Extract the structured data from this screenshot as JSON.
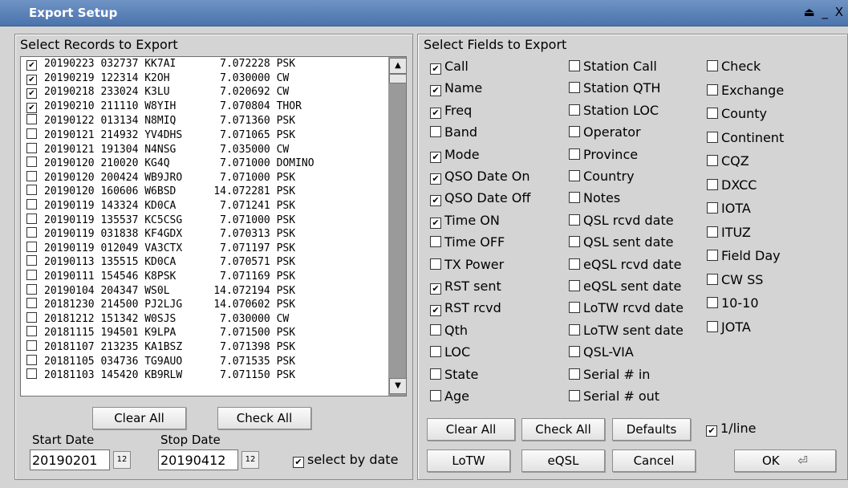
{
  "window": {
    "title": "Export Setup",
    "controls": "⏏ _ X"
  },
  "left": {
    "title": "Select Records to Export",
    "records": [
      {
        "checked": true,
        "text": "20190223 032737 KK7AI       7.072228 PSK"
      },
      {
        "checked": true,
        "text": "20190219 122314 K2OH        7.030000 CW"
      },
      {
        "checked": true,
        "text": "20190218 233024 K3LU        7.020692 CW"
      },
      {
        "checked": true,
        "text": "20190210 211110 W8YIH       7.070804 THOR"
      },
      {
        "checked": false,
        "text": "20190122 013134 N8MIQ       7.071360 PSK"
      },
      {
        "checked": false,
        "text": "20190121 214932 YV4DHS      7.071065 PSK"
      },
      {
        "checked": false,
        "text": "20190121 191304 N4NSG       7.035000 CW"
      },
      {
        "checked": false,
        "text": "20190120 210020 KG4Q        7.071000 DOMINO"
      },
      {
        "checked": false,
        "text": "20190120 200424 WB9JRO      7.071000 PSK"
      },
      {
        "checked": false,
        "text": "20190120 160606 W6BSD      14.072281 PSK"
      },
      {
        "checked": false,
        "text": "20190119 143324 KD0CA       7.071241 PSK"
      },
      {
        "checked": false,
        "text": "20190119 135537 KC5CSG      7.071000 PSK"
      },
      {
        "checked": false,
        "text": "20190119 031838 KF4GDX      7.070313 PSK"
      },
      {
        "checked": false,
        "text": "20190119 012049 VA3CTX      7.071197 PSK"
      },
      {
        "checked": false,
        "text": "20190113 135515 KD0CA       7.070571 PSK"
      },
      {
        "checked": false,
        "text": "20190111 154546 K8PSK       7.071169 PSK"
      },
      {
        "checked": false,
        "text": "20190104 204347 WS0L       14.072194 PSK"
      },
      {
        "checked": false,
        "text": "20181230 214500 PJ2LJG     14.070602 PSK"
      },
      {
        "checked": false,
        "text": "20181212 151342 W0SJS       7.030000 CW"
      },
      {
        "checked": false,
        "text": "20181115 194501 K9LPA       7.071500 PSK"
      },
      {
        "checked": false,
        "text": "20181107 213235 KA1BSZ      7.071398 PSK"
      },
      {
        "checked": false,
        "text": "20181105 034736 TG9AUO      7.071535 PSK"
      },
      {
        "checked": false,
        "text": "20181103 145420 KB9RLW      7.071150 PSK"
      }
    ],
    "clear_all": "Clear All",
    "check_all": "Check All",
    "start_label": "Start Date",
    "stop_label": "Stop Date",
    "start_value": "20190201",
    "stop_value": "20190412",
    "select_by_date": "select by date"
  },
  "right": {
    "title": "Select Fields to Export",
    "col1": [
      {
        "label": "Call",
        "checked": true
      },
      {
        "label": "Name",
        "checked": true
      },
      {
        "label": "Freq",
        "checked": true
      },
      {
        "label": "Band",
        "checked": false
      },
      {
        "label": "Mode",
        "checked": true
      },
      {
        "label": "QSO Date On",
        "checked": true
      },
      {
        "label": "QSO Date Off",
        "checked": true
      },
      {
        "label": "Time ON",
        "checked": true
      },
      {
        "label": "Time OFF",
        "checked": false
      },
      {
        "label": "TX Power",
        "checked": false
      },
      {
        "label": "RST sent",
        "checked": true
      },
      {
        "label": "RST rcvd",
        "checked": true
      },
      {
        "label": "Qth",
        "checked": false
      },
      {
        "label": "LOC",
        "checked": false
      },
      {
        "label": "State",
        "checked": false
      },
      {
        "label": "Age",
        "checked": false
      }
    ],
    "col2": [
      {
        "label": "Station Call",
        "checked": false
      },
      {
        "label": "Station QTH",
        "checked": false
      },
      {
        "label": "Station LOC",
        "checked": false
      },
      {
        "label": "Operator",
        "checked": false
      },
      {
        "label": "Province",
        "checked": false
      },
      {
        "label": "Country",
        "checked": false
      },
      {
        "label": "Notes",
        "checked": false
      },
      {
        "label": "QSL rcvd date",
        "checked": false
      },
      {
        "label": "QSL sent date",
        "checked": false
      },
      {
        "label": "eQSL rcvd date",
        "checked": false
      },
      {
        "label": "eQSL sent date",
        "checked": false
      },
      {
        "label": "LoTW rcvd date",
        "checked": false
      },
      {
        "label": "LoTW sent date",
        "checked": false
      },
      {
        "label": "QSL-VIA",
        "checked": false
      },
      {
        "label": "Serial # in",
        "checked": false
      },
      {
        "label": "Serial # out",
        "checked": false
      }
    ],
    "col3": [
      {
        "label": "Check",
        "checked": false
      },
      {
        "label": "Exchange",
        "checked": false
      },
      {
        "label": "County",
        "checked": false
      },
      {
        "label": "Continent",
        "checked": false
      },
      {
        "label": "CQZ",
        "checked": false
      },
      {
        "label": "DXCC",
        "checked": false
      },
      {
        "label": "IOTA",
        "checked": false
      },
      {
        "label": "ITUZ",
        "checked": false
      },
      {
        "label": "Field Day",
        "checked": false
      },
      {
        "label": "CW SS",
        "checked": false
      },
      {
        "label": "10-10",
        "checked": false
      },
      {
        "label": "JOTA",
        "checked": false
      }
    ],
    "clear_all": "Clear All",
    "check_all": "Check All",
    "defaults": "Defaults",
    "one_per_line": "1/line",
    "lotw": "LoTW",
    "eqsl": "eQSL",
    "cancel": "Cancel",
    "ok": "OK"
  }
}
